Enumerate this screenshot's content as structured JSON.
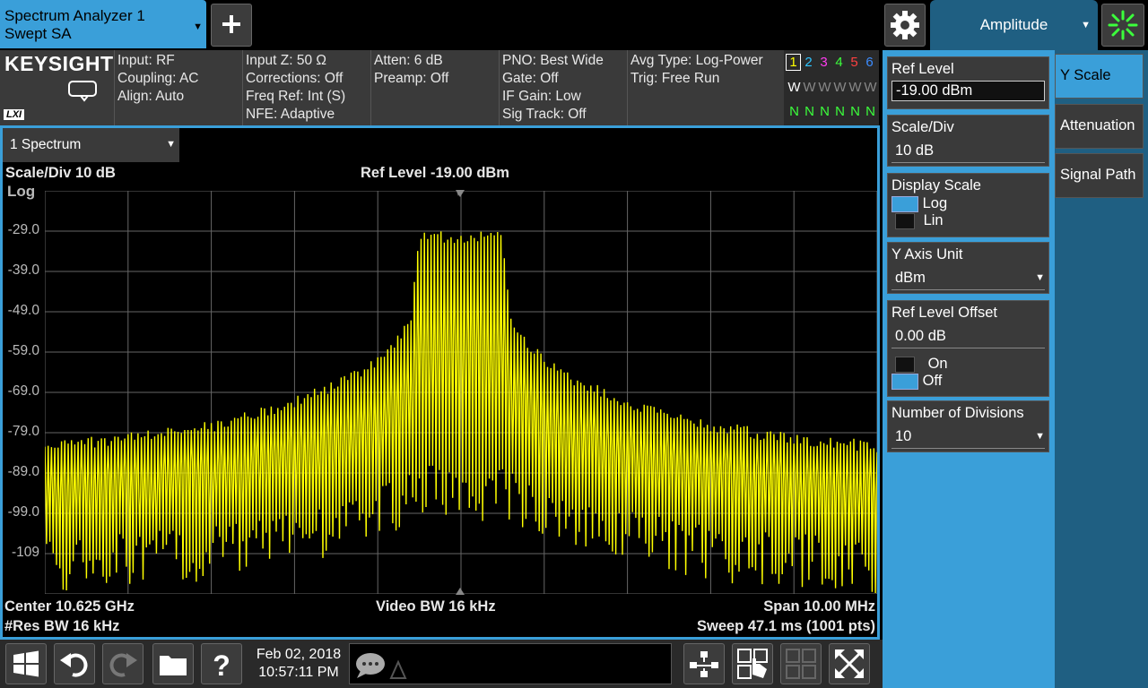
{
  "top": {
    "mode_line1": "Spectrum Analyzer 1",
    "mode_line2": "Swept SA",
    "menu_title": "Amplitude"
  },
  "info": {
    "brand": "KEYSIGHT",
    "lxi": "LXI",
    "col1": [
      "Input: RF",
      "Coupling: AC",
      "Align: Auto"
    ],
    "col2": [
      "Input Z: 50 Ω",
      "Corrections: Off",
      "Freq Ref: Int (S)",
      "NFE: Adaptive"
    ],
    "col3": [
      "Atten: 6 dB",
      "Preamp: Off"
    ],
    "col4": [
      "PNO: Best Wide",
      "Gate: Off",
      "IF Gain: Low",
      "Sig Track: Off"
    ],
    "col5": [
      "Avg Type: Log-Power",
      "Trig: Free Run"
    ],
    "traces": [
      "1",
      "2",
      "3",
      "4",
      "5",
      "6"
    ],
    "trace_colors": [
      "#ffff00",
      "#2ec4ff",
      "#ff3cf0",
      "#3cff3c",
      "#ff4040",
      "#3c8cff"
    ],
    "trace_type_row": [
      "W",
      "W",
      "W",
      "W",
      "W",
      "W"
    ],
    "trace_det_row": [
      "N",
      "N",
      "N",
      "N",
      "N",
      "N"
    ]
  },
  "graph": {
    "window_select": "1 Spectrum",
    "scale_div": "Scale/Div 10 dB",
    "ref_level": "Ref Level -19.00 dBm",
    "scale_type": "Log",
    "y_ticks": [
      "-29.0",
      "-39.0",
      "-49.0",
      "-59.0",
      "-69.0",
      "-79.0",
      "-89.0",
      "-99.0",
      "-109"
    ],
    "center": "Center 10.625 GHz",
    "res_bw": "#Res BW 16 kHz",
    "video_bw": "Video BW 16 kHz",
    "span": "Span 10.00 MHz",
    "sweep": "Sweep 47.1 ms (1001 pts)",
    "trace_color": "#ffff00"
  },
  "chart_data": {
    "type": "line",
    "ylim": [
      -119,
      -19
    ],
    "xlabel": "",
    "ylabel": "",
    "grid": true,
    "description_free": true,
    "envelope_x_mhz": [
      -5.0,
      -4.0,
      -3.0,
      -2.0,
      -1.5,
      -1.0,
      -0.6,
      -0.5,
      0.0,
      0.5,
      0.6,
      1.0,
      1.5,
      2.0,
      3.0,
      4.0,
      5.0
    ],
    "envelope_peak_dbm": [
      -81,
      -79,
      -76,
      -70,
      -66,
      -60,
      -50,
      -29,
      -29,
      -29,
      -50,
      -60,
      -66,
      -70,
      -76,
      -79,
      -81
    ],
    "noise_floor_dbm": [
      -105,
      -104,
      -102,
      -98,
      -96,
      -93,
      -88,
      -87,
      -87,
      -87,
      -88,
      -93,
      -96,
      -98,
      -102,
      -104,
      -105
    ]
  },
  "bottom": {
    "date": "Feb 02, 2018",
    "time": "10:57:11 PM"
  },
  "softkeys": {
    "ref_level_label": "Ref Level",
    "ref_level_value": "-19.00 dBm",
    "scale_div_label": "Scale/Div",
    "scale_div_value": "10 dB",
    "display_scale_label": "Display Scale",
    "log": "Log",
    "lin": "Lin",
    "y_axis_unit_label": "Y Axis Unit",
    "y_axis_unit_value": "dBm",
    "ref_offset_label": "Ref Level Offset",
    "ref_offset_value": "0.00 dB",
    "on": "On",
    "off": "Off",
    "divisions_label": "Number of Divisions",
    "divisions_value": "10"
  },
  "side_tabs": [
    "Y Scale",
    "Attenuation",
    "Signal Path"
  ]
}
